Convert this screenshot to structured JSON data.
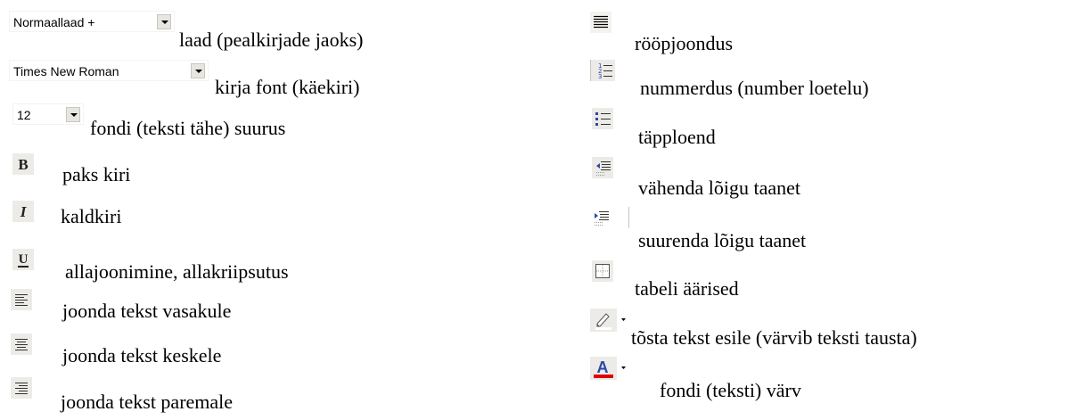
{
  "left_column": {
    "style_combo": {
      "value": "Normaallaad +",
      "label": "laad (pealkirjade jaoks)"
    },
    "font_combo": {
      "value": "Times New Roman",
      "label": "kirja font (käekiri)"
    },
    "size_combo": {
      "value": "12",
      "label": "fondi (teksti tähe) suurus"
    },
    "bold": {
      "label": "paks kiri"
    },
    "italic": {
      "label": "kaldkiri"
    },
    "underline": {
      "label": "allajoonimine, allakriipsutus"
    },
    "align_left": {
      "label": "joonda tekst vasakule"
    },
    "align_center": {
      "label": "joonda tekst keskele"
    },
    "align_right": {
      "label": "joonda tekst paremale"
    }
  },
  "right_column": {
    "justify": {
      "label": "rööpjoondus"
    },
    "numbering": {
      "label": "nummerdus (number loetelu)"
    },
    "bullets": {
      "label": "täpploend"
    },
    "decrease_indent": {
      "label": "vähenda lõigu taanet"
    },
    "increase_indent": {
      "label": "suurenda lõigu taanet"
    },
    "borders": {
      "label": "tabeli äärised"
    },
    "highlight": {
      "label": "tõsta tekst esile (värvib teksti tausta)"
    },
    "font_color": {
      "label": "fondi (teksti) värv"
    }
  },
  "icons": [
    "bold-icon",
    "italic-icon",
    "underline-icon",
    "align-left-icon",
    "align-center-icon",
    "align-right-icon",
    "justify-icon",
    "numbering-icon",
    "bullets-icon",
    "decrease-indent-icon",
    "increase-indent-icon",
    "borders-icon",
    "highlighter-icon",
    "font-color-icon"
  ],
  "colors": {
    "icon_blue": "#3344aa",
    "font_color_bar": "#e00000",
    "button_face": "#ecebe7"
  }
}
